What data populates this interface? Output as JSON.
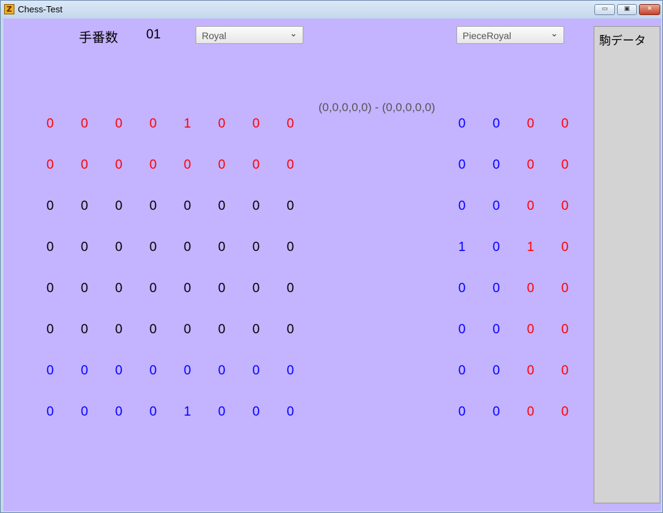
{
  "window": {
    "title": "Chess-Test",
    "app_icon": "Z",
    "controls": {
      "minimize": "▭",
      "maximize": "▣",
      "close": "✕"
    }
  },
  "header": {
    "move_label": "手番数",
    "move_value": "01",
    "combo1": "Royal",
    "combo2": "PieceRoyal",
    "chevron": "⌄"
  },
  "position_text": "(0,0,0,0,0) - (0,0,0,0,0)",
  "colors": {
    "red": "#ff0000",
    "blue": "#0000ff",
    "black": "#000000",
    "client_bg": "#c4b3ff"
  },
  "board": {
    "rows": [
      [
        "0",
        "0",
        "0",
        "0",
        "1",
        "0",
        "0",
        "0"
      ],
      [
        "0",
        "0",
        "0",
        "0",
        "0",
        "0",
        "0",
        "0"
      ],
      [
        "0",
        "0",
        "0",
        "0",
        "0",
        "0",
        "0",
        "0"
      ],
      [
        "0",
        "0",
        "0",
        "0",
        "0",
        "0",
        "0",
        "0"
      ],
      [
        "0",
        "0",
        "0",
        "0",
        "0",
        "0",
        "0",
        "0"
      ],
      [
        "0",
        "0",
        "0",
        "0",
        "0",
        "0",
        "0",
        "0"
      ],
      [
        "0",
        "0",
        "0",
        "0",
        "0",
        "0",
        "0",
        "0"
      ],
      [
        "0",
        "0",
        "0",
        "0",
        "1",
        "0",
        "0",
        "0"
      ]
    ],
    "row_colors": [
      "red",
      "red",
      "black",
      "black",
      "black",
      "black",
      "blue",
      "blue"
    ]
  },
  "side_grid": {
    "rows": [
      [
        "0",
        "0",
        "0",
        "0"
      ],
      [
        "0",
        "0",
        "0",
        "0"
      ],
      [
        "0",
        "0",
        "0",
        "0"
      ],
      [
        "1",
        "0",
        "1",
        "0"
      ],
      [
        "0",
        "0",
        "0",
        "0"
      ],
      [
        "0",
        "0",
        "0",
        "0"
      ],
      [
        "0",
        "0",
        "0",
        "0"
      ],
      [
        "0",
        "0",
        "0",
        "0"
      ]
    ],
    "col_colors": [
      "blue",
      "blue",
      "red",
      "red"
    ]
  },
  "panel": {
    "title": "駒データ"
  }
}
